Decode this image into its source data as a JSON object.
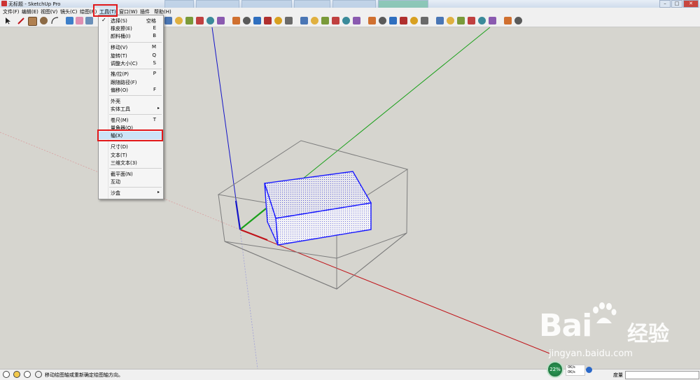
{
  "window": {
    "title": "无标题 - SketchUp Pro"
  },
  "menubar": {
    "items": [
      "文件(F)",
      "编辑(E)",
      "视图(V)",
      "镜头(C)",
      "绘图(R)",
      "工具(T)",
      "窗口(W)",
      "插件",
      "帮助(H)"
    ]
  },
  "tools_menu": {
    "items": [
      {
        "label": "选择(S)",
        "shortcut": "空格",
        "checked": "✓"
      },
      {
        "label": "橡皮擦(E)",
        "shortcut": "E"
      },
      {
        "label": "颜料桶(I)",
        "shortcut": "B"
      },
      {
        "label": "移动(V)",
        "shortcut": "M"
      },
      {
        "label": "旋转(T)",
        "shortcut": "Q"
      },
      {
        "label": "调整大小(C)",
        "shortcut": "S"
      },
      {
        "label": "推/拉(P)",
        "shortcut": "P"
      },
      {
        "label": "跟随路径(F)",
        "shortcut": ""
      },
      {
        "label": "偏移(O)",
        "shortcut": "F"
      },
      {
        "label": "外壳",
        "shortcut": ""
      },
      {
        "label": "实体工具",
        "submenu_arrow": "▸"
      },
      {
        "label": "卷尺(M)",
        "shortcut": "T"
      },
      {
        "label": "量角器(O)",
        "shortcut": ""
      },
      {
        "label": "轴(X)",
        "shortcut": ""
      },
      {
        "label": "尺寸(D)",
        "shortcut": ""
      },
      {
        "label": "文本(T)",
        "shortcut": ""
      },
      {
        "label": "三维文本(3)",
        "shortcut": ""
      },
      {
        "label": "截平面(N)",
        "shortcut": ""
      },
      {
        "label": "互动",
        "shortcut": ""
      },
      {
        "label": "沙盒",
        "submenu_arrow": "▸"
      }
    ]
  },
  "statusbar": {
    "message": "移动绘图轴或重新确定绘图轴方向。",
    "measurement_label": "度量",
    "measurement_value": ""
  },
  "net_widget": {
    "cpu_percent": "22%",
    "upload": "0K/s",
    "download": "0K/s"
  },
  "watermark": {
    "brand_latin": "Bai",
    "brand_cn": "经验",
    "url": "jingyan.baidu.com"
  },
  "colors": {
    "highlight_box": "#e1191b",
    "axis_red": "#c0141a",
    "axis_green": "#1aa01a",
    "axis_blue": "#1414c8",
    "selection_blue": "#1a1aff"
  },
  "toolbar": {
    "icons": [
      "select-icon",
      "pencil-icon",
      "rectangle-icon",
      "circle-icon",
      "arc-icon",
      "make-component-icon",
      "eraser-icon",
      "tape-measure-icon",
      "paint-bucket-icon",
      "push-pull-icon",
      "move-icon",
      "rotate-icon",
      "follow-me-icon",
      "offset-icon",
      "orbit-icon",
      "pan-icon",
      "zoom-icon",
      "zoom-extents-icon",
      "previous-view-icon",
      "next-view-icon",
      "walk-icon",
      "look-around-icon",
      "position-camera-icon",
      "section-plane-icon",
      "shadow-icon",
      "fog-icon",
      "xray-icon",
      "back-edges-icon",
      "wireframe-icon",
      "hidden-line-icon",
      "shaded-icon",
      "textured-icon",
      "monochrome-icon",
      "get-models-icon",
      "share-model-icon",
      "share-component-icon",
      "extension-warehouse-icon",
      "send-to-layout-icon",
      "preview-icon",
      "google-earth-icon"
    ]
  }
}
